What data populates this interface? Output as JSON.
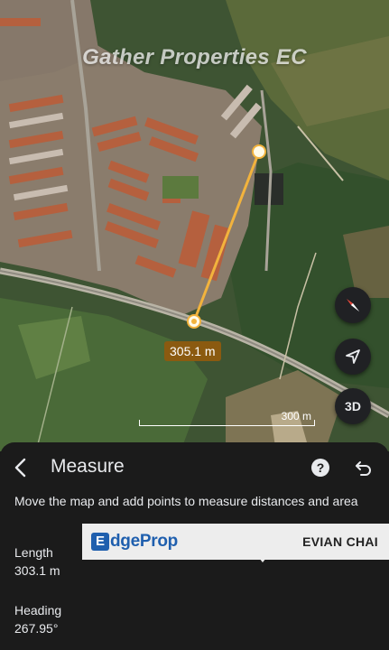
{
  "map": {
    "watermark": "Gather Properties EC",
    "distance_label": "305.1 m",
    "scale_label": "300 m",
    "buttons": {
      "compass_icon": "compass-icon",
      "locate_icon": "navigation-arrow-icon",
      "three_d_label": "3D"
    }
  },
  "panel": {
    "title": "Measure",
    "back_icon": "chevron-left-icon",
    "help_label": "?",
    "undo_icon": "undo-icon",
    "instructions": "Move the map and add points to measure distances and area",
    "length_label": "Length",
    "length_value": "303.1 m",
    "heading_label": "Heading",
    "heading_value": "267.95°"
  },
  "ad": {
    "brand_mark": "E",
    "brand_rest": "dgeProp",
    "agent_name": "EVIAN CHAI"
  },
  "colors": {
    "measure_line": "#f2b33d",
    "panel_bg": "#1b1b1b",
    "button_bg": "#202124",
    "distance_chip": "#8b5a10",
    "edgeprop_blue": "#1f5fae"
  }
}
